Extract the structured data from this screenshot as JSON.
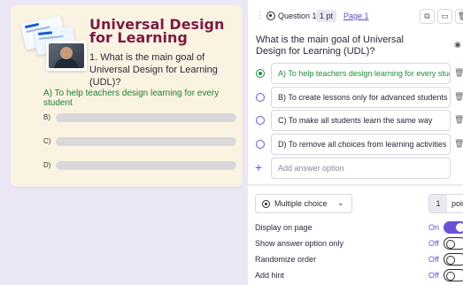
{
  "preview": {
    "title": "Universal Design for Learning",
    "question": "1. What is the main goal of Universal Design for Learning (UDL)?",
    "correct_answer": "A) To help teachers design learning for every student",
    "rows": [
      {
        "label": "B)"
      },
      {
        "label": "C)"
      },
      {
        "label": "D)"
      }
    ]
  },
  "editor": {
    "question_label": "Question 1",
    "points_pill": "1 pt",
    "page_link": "Page 1",
    "question_text": "What is the main goal of Universal Design for Learning (UDL)?",
    "options": [
      {
        "text": "A) To help teachers design learning for every student",
        "correct": true
      },
      {
        "text": "B) To create lessons only for advanced students",
        "correct": false
      },
      {
        "text": "C) To make all students learn the same way",
        "correct": false
      },
      {
        "text": "D) To remove all choices from learning activities",
        "correct": false
      }
    ],
    "add_option_placeholder": "Add answer option",
    "question_type": "Multiple choice",
    "points_value": "1",
    "points_unit": "points",
    "settings": [
      {
        "label": "Display on page",
        "state": "On",
        "on": true
      },
      {
        "label": "Show answer option only",
        "state": "Off",
        "on": false
      },
      {
        "label": "Randomize order",
        "state": "Off",
        "on": false
      },
      {
        "label": "Add hint",
        "state": "Off",
        "on": false
      }
    ]
  },
  "colors": {
    "accent": "#6b51d9",
    "title": "#7a1c42",
    "correct": "#1e8e3e",
    "preview_bg": "#fbf3e2",
    "page_bg": "#ece7f4"
  }
}
